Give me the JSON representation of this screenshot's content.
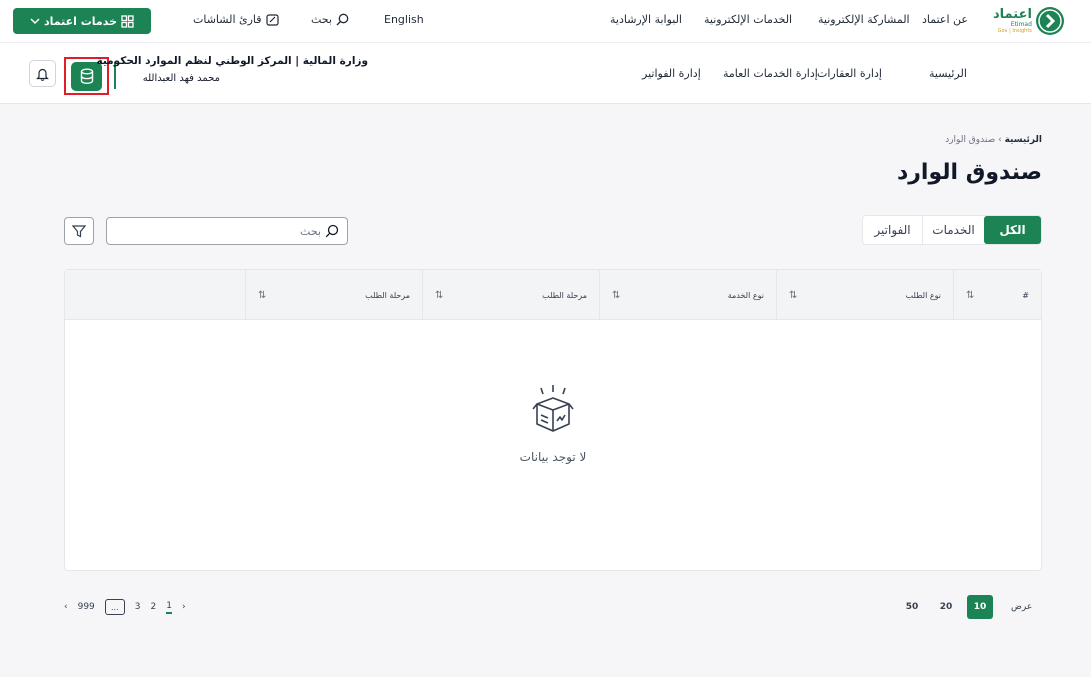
{
  "topbar": {
    "services_button": "خدمات اعتماد",
    "screen_reader": "قارئ الشاشات",
    "search": "بحث",
    "language": "English",
    "links": [
      "البوابة الإرشادية",
      "الخدمات الإلكترونية",
      "المشاركة الإلكترونية",
      "عن اعتماد"
    ],
    "logo_text": "اعتماد",
    "logo_sub": "Etimad",
    "logo_tag": "Gov | Insights"
  },
  "navbar": {
    "org": "وزارة المالية | المركز الوطني لنظم الموارد الحكومية",
    "user_name": "محمد فهد العبدالله",
    "items": [
      "الرئيسية",
      "إدارة العقارات",
      "إدارة الخدمات العامة",
      "إدارة الفواتير"
    ]
  },
  "breadcrumb": {
    "home": "الرئيسية",
    "separator": "›",
    "current": "صندوق الوارد"
  },
  "page_title": "صندوق الوارد",
  "tabs": [
    "الكل",
    "الخدمات",
    "الفواتير"
  ],
  "search": {
    "placeholder": "بحث"
  },
  "table": {
    "columns": [
      "#",
      "نوع الطلب",
      "نوع الخدمة",
      "مرحلة الطلب",
      "مرحلة الطلب",
      ""
    ],
    "empty_text": "لا توجد بيانات"
  },
  "pagination": {
    "prev": "‹",
    "next": "›",
    "pages": [
      "1",
      "2",
      "3"
    ],
    "ellipsis": "...",
    "last": "999",
    "current": "1"
  },
  "page_size": {
    "label": "عرض",
    "options": [
      "10",
      "20",
      "50"
    ],
    "selected": "10"
  },
  "colors": {
    "brand": "#1b8354",
    "highlight": "#e11d2a"
  }
}
